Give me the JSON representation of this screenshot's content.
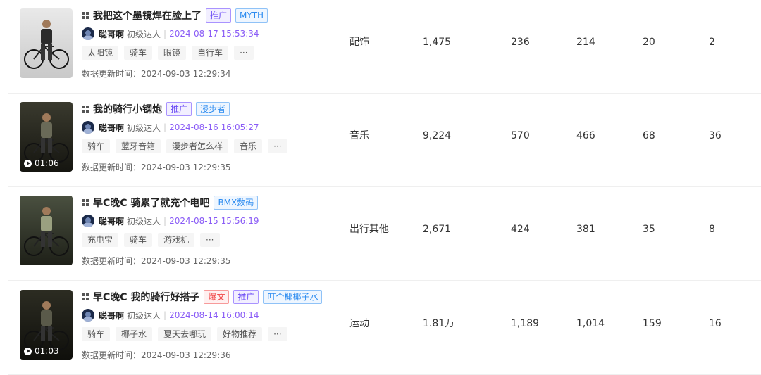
{
  "accent_colors": {
    "promo": "#6c4cf5",
    "brand": "#2d8cf0",
    "hot": "#f04646",
    "time": "#8a5cf6"
  },
  "rows": [
    {
      "title": "我把这个墨镜焊在脸上了",
      "badges": [
        {
          "text": "推广",
          "kind": "promo"
        },
        {
          "text": "MYTH",
          "kind": "brand"
        }
      ],
      "author": "聪哥啊",
      "level": "初级达人",
      "published": "2024-08-17 15:53:34",
      "tags": [
        "太阳镜",
        "骑车",
        "眼镜",
        "自行车",
        "···"
      ],
      "update_label": "数据更新时间：",
      "update_time": "2024-09-03 12:29:34",
      "duration": "",
      "category": "配饰",
      "c1": "1,475",
      "c2": "236",
      "c3": "214",
      "c4": "20",
      "c5": "2"
    },
    {
      "title": "我的骑行小钢炮",
      "badges": [
        {
          "text": "推广",
          "kind": "promo"
        },
        {
          "text": "漫步者",
          "kind": "brand"
        }
      ],
      "author": "聪哥啊",
      "level": "初级达人",
      "published": "2024-08-16 16:05:27",
      "tags": [
        "骑车",
        "蓝牙音箱",
        "漫步者怎么样",
        "音乐",
        "···"
      ],
      "update_label": "数据更新时间：",
      "update_time": "2024-09-03 12:29:35",
      "duration": "01:06",
      "category": "音乐",
      "c1": "9,224",
      "c2": "570",
      "c3": "466",
      "c4": "68",
      "c5": "36"
    },
    {
      "title": "早C晚C 骑累了就充个电吧",
      "badges": [
        {
          "text": "BMX数码",
          "kind": "brand"
        }
      ],
      "author": "聪哥啊",
      "level": "初级达人",
      "published": "2024-08-15 15:56:19",
      "tags": [
        "充电宝",
        "骑车",
        "游戏机",
        "···"
      ],
      "update_label": "数据更新时间：",
      "update_time": "2024-09-03 12:29:35",
      "duration": "",
      "category": "出行其他",
      "c1": "2,671",
      "c2": "424",
      "c3": "381",
      "c4": "35",
      "c5": "8"
    },
    {
      "title": "早C晚C 我的骑行好搭子",
      "badges": [
        {
          "text": "爆文",
          "kind": "hot"
        },
        {
          "text": "推广",
          "kind": "promo"
        },
        {
          "text": "叮个椰椰子水",
          "kind": "brand"
        }
      ],
      "author": "聪哥啊",
      "level": "初级达人",
      "published": "2024-08-14 16:00:14",
      "tags": [
        "骑车",
        "椰子水",
        "夏天去哪玩",
        "好物推荐",
        "···"
      ],
      "update_label": "数据更新时间：",
      "update_time": "2024-09-03 12:29:36",
      "duration": "01:03",
      "category": "运动",
      "c1": "1.81万",
      "c2": "1,189",
      "c3": "1,014",
      "c4": "159",
      "c5": "16"
    }
  ]
}
